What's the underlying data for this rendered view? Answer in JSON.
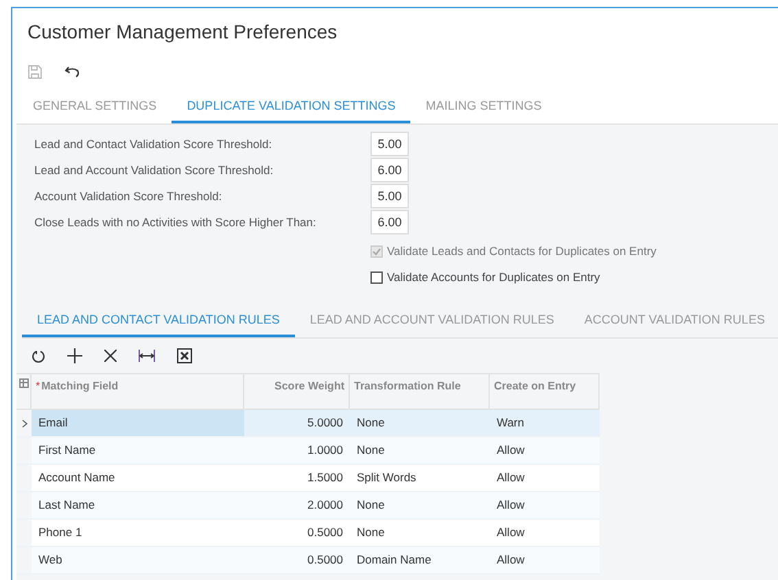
{
  "title": "Customer Management Preferences",
  "tabs": [
    {
      "label": "GENERAL SETTINGS",
      "selected": false
    },
    {
      "label": "DUPLICATE VALIDATION SETTINGS",
      "selected": true
    },
    {
      "label": "MAILING SETTINGS",
      "selected": false
    }
  ],
  "form": [
    {
      "label": "Lead and Contact Validation Score Threshold:",
      "value": "5.00"
    },
    {
      "label": "Lead and Account Validation Score Threshold:",
      "value": "6.00"
    },
    {
      "label": "Account Validation Score Threshold:",
      "value": "5.00"
    },
    {
      "label": "Close Leads with no Activities with Score Higher Than:",
      "value": "6.00"
    }
  ],
  "checkboxes": [
    {
      "label": "Validate Leads and Contacts for Duplicates on Entry",
      "checked": true,
      "disabled": true
    },
    {
      "label": "Validate Accounts for Duplicates on Entry",
      "checked": false,
      "disabled": false
    }
  ],
  "rule_tabs": [
    {
      "label": "LEAD AND CONTACT VALIDATION RULES",
      "selected": true
    },
    {
      "label": "LEAD AND ACCOUNT VALIDATION RULES",
      "selected": false
    },
    {
      "label": "ACCOUNT VALIDATION RULES",
      "selected": false
    }
  ],
  "table": {
    "columns": [
      {
        "label": "Matching Field",
        "required_marker": "*"
      },
      {
        "label": "Score Weight"
      },
      {
        "label": "Transformation Rule"
      },
      {
        "label": "Create on Entry"
      }
    ],
    "rows": [
      {
        "selected": true,
        "cells": [
          "Email",
          "5.0000",
          "None",
          "Warn"
        ]
      },
      {
        "selected": false,
        "cells": [
          "First Name",
          "1.0000",
          "None",
          "Allow"
        ]
      },
      {
        "selected": false,
        "cells": [
          "Account Name",
          "1.5000",
          "Split Words",
          "Allow"
        ]
      },
      {
        "selected": false,
        "cells": [
          "Last Name",
          "2.0000",
          "None",
          "Allow"
        ]
      },
      {
        "selected": false,
        "cells": [
          "Phone 1",
          "0.5000",
          "None",
          "Allow"
        ]
      },
      {
        "selected": false,
        "cells": [
          "Web",
          "0.5000",
          "Domain Name",
          "Allow"
        ]
      }
    ]
  }
}
